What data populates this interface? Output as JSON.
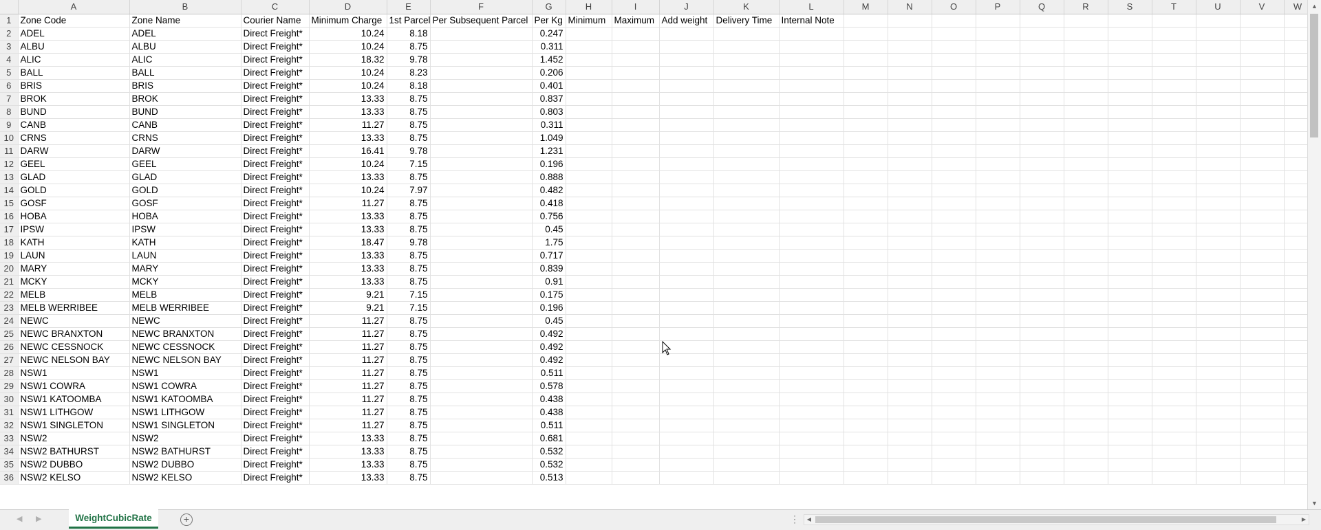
{
  "columns": [
    "A",
    "B",
    "C",
    "D",
    "E",
    "F",
    "G",
    "H",
    "I",
    "J",
    "K",
    "L",
    "M",
    "N",
    "O",
    "P",
    "Q",
    "R",
    "S",
    "T",
    "U",
    "V",
    "W"
  ],
  "rows": [
    [
      "1",
      "Zone Code",
      "Zone Name",
      "Courier Name",
      "Minimum Charge",
      "1st Parcel",
      "Per Subsequent Parcel",
      "Per Kg",
      "Minimum",
      "Maximum",
      "Add weight",
      "Delivery Time",
      "Internal Note"
    ],
    [
      "2",
      "ADEL",
      "ADEL",
      "Direct Freight*",
      "10.24",
      "8.18",
      "",
      "0.247"
    ],
    [
      "3",
      "ALBU",
      "ALBU",
      "Direct Freight*",
      "10.24",
      "8.75",
      "",
      "0.311"
    ],
    [
      "4",
      "ALIC",
      "ALIC",
      "Direct Freight*",
      "18.32",
      "9.78",
      "",
      "1.452"
    ],
    [
      "5",
      "BALL",
      "BALL",
      "Direct Freight*",
      "10.24",
      "8.23",
      "",
      "0.206"
    ],
    [
      "6",
      "BRIS",
      "BRIS",
      "Direct Freight*",
      "10.24",
      "8.18",
      "",
      "0.401"
    ],
    [
      "7",
      "BROK",
      "BROK",
      "Direct Freight*",
      "13.33",
      "8.75",
      "",
      "0.837"
    ],
    [
      "8",
      "BUND",
      "BUND",
      "Direct Freight*",
      "13.33",
      "8.75",
      "",
      "0.803"
    ],
    [
      "9",
      "CANB",
      "CANB",
      "Direct Freight*",
      "11.27",
      "8.75",
      "",
      "0.311"
    ],
    [
      "10",
      "CRNS",
      "CRNS",
      "Direct Freight*",
      "13.33",
      "8.75",
      "",
      "1.049"
    ],
    [
      "11",
      "DARW",
      "DARW",
      "Direct Freight*",
      "16.41",
      "9.78",
      "",
      "1.231"
    ],
    [
      "12",
      "GEEL",
      "GEEL",
      "Direct Freight*",
      "10.24",
      "7.15",
      "",
      "0.196"
    ],
    [
      "13",
      "GLAD",
      "GLAD",
      "Direct Freight*",
      "13.33",
      "8.75",
      "",
      "0.888"
    ],
    [
      "14",
      "GOLD",
      "GOLD",
      "Direct Freight*",
      "10.24",
      "7.97",
      "",
      "0.482"
    ],
    [
      "15",
      "GOSF",
      "GOSF",
      "Direct Freight*",
      "11.27",
      "8.75",
      "",
      "0.418"
    ],
    [
      "16",
      "HOBA",
      "HOBA",
      "Direct Freight*",
      "13.33",
      "8.75",
      "",
      "0.756"
    ],
    [
      "17",
      "IPSW",
      "IPSW",
      "Direct Freight*",
      "13.33",
      "8.75",
      "",
      "0.45"
    ],
    [
      "18",
      "KATH",
      "KATH",
      "Direct Freight*",
      "18.47",
      "9.78",
      "",
      "1.75"
    ],
    [
      "19",
      "LAUN",
      "LAUN",
      "Direct Freight*",
      "13.33",
      "8.75",
      "",
      "0.717"
    ],
    [
      "20",
      "MARY",
      "MARY",
      "Direct Freight*",
      "13.33",
      "8.75",
      "",
      "0.839"
    ],
    [
      "21",
      "MCKY",
      "MCKY",
      "Direct Freight*",
      "13.33",
      "8.75",
      "",
      "0.91"
    ],
    [
      "22",
      "MELB",
      "MELB",
      "Direct Freight*",
      "9.21",
      "7.15",
      "",
      "0.175"
    ],
    [
      "23",
      "MELB WERRIBEE",
      "MELB WERRIBEE",
      "Direct Freight*",
      "9.21",
      "7.15",
      "",
      "0.196"
    ],
    [
      "24",
      "NEWC",
      "NEWC",
      "Direct Freight*",
      "11.27",
      "8.75",
      "",
      "0.45"
    ],
    [
      "25",
      "NEWC BRANXTON",
      "NEWC BRANXTON",
      "Direct Freight*",
      "11.27",
      "8.75",
      "",
      "0.492"
    ],
    [
      "26",
      "NEWC CESSNOCK",
      "NEWC CESSNOCK",
      "Direct Freight*",
      "11.27",
      "8.75",
      "",
      "0.492"
    ],
    [
      "27",
      "NEWC NELSON BAY",
      "NEWC NELSON BAY",
      "Direct Freight*",
      "11.27",
      "8.75",
      "",
      "0.492"
    ],
    [
      "28",
      "NSW1",
      "NSW1",
      "Direct Freight*",
      "11.27",
      "8.75",
      "",
      "0.511"
    ],
    [
      "29",
      "NSW1 COWRA",
      "NSW1 COWRA",
      "Direct Freight*",
      "11.27",
      "8.75",
      "",
      "0.578"
    ],
    [
      "30",
      "NSW1 KATOOMBA",
      "NSW1 KATOOMBA",
      "Direct Freight*",
      "11.27",
      "8.75",
      "",
      "0.438"
    ],
    [
      "31",
      "NSW1 LITHGOW",
      "NSW1 LITHGOW",
      "Direct Freight*",
      "11.27",
      "8.75",
      "",
      "0.438"
    ],
    [
      "32",
      "NSW1 SINGLETON",
      "NSW1 SINGLETON",
      "Direct Freight*",
      "11.27",
      "8.75",
      "",
      "0.511"
    ],
    [
      "33",
      "NSW2",
      "NSW2",
      "Direct Freight*",
      "13.33",
      "8.75",
      "",
      "0.681"
    ],
    [
      "34",
      "NSW2 BATHURST",
      "NSW2 BATHURST",
      "Direct Freight*",
      "13.33",
      "8.75",
      "",
      "0.532"
    ],
    [
      "35",
      "NSW2 DUBBO",
      "NSW2 DUBBO",
      "Direct Freight*",
      "13.33",
      "8.75",
      "",
      "0.532"
    ],
    [
      "36",
      "NSW2 KELSO",
      "NSW2 KELSO",
      "Direct Freight*",
      "13.33",
      "8.75",
      "",
      "0.513"
    ]
  ],
  "sheet_tab": "WeightCubicRate",
  "add_sheet_symbol": "+",
  "accent_color": "#217346"
}
